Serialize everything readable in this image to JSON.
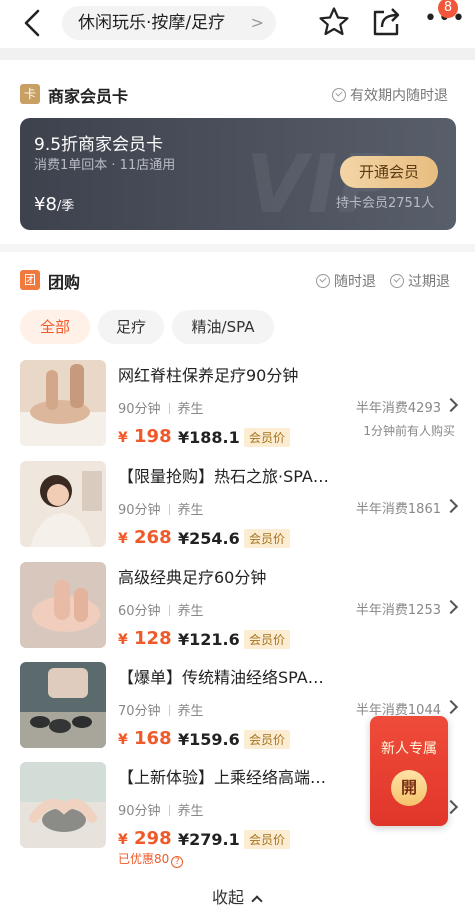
{
  "header": {
    "breadcrumb": "休闲玩乐·按摩/足疗",
    "badge_count": "8"
  },
  "member_card": {
    "section_icon": "卡",
    "section_title": "商家会员卡",
    "refund_note": "有效期内随时退",
    "card_title": "9.5折商家会员卡",
    "card_subtitle": "消费1单回本 · 11店通用",
    "price": "¥8",
    "price_unit": "/季",
    "open_button": "开通会员",
    "holders": "持卡会员2751人"
  },
  "group_buy": {
    "section_icon": "团",
    "section_title": "团购",
    "tag_anytime": "随时退",
    "tag_expired": "过期退",
    "tabs": [
      "全部",
      "足疗",
      "精油/SPA"
    ],
    "deals": [
      {
        "title": "网红脊柱保养足疗90分钟",
        "duration": "90分钟",
        "category": "养生",
        "sales": "半年消费4293",
        "extra": "1分钟前有人购买",
        "price": "198",
        "member_price": "¥188.1",
        "member_tag": "会员价",
        "icon": "massage-back-photo"
      },
      {
        "title": "【限量抢购】热石之旅·SPA…",
        "duration": "90分钟",
        "category": "养生",
        "sales": "半年消费1861",
        "extra": "",
        "price": "268",
        "member_price": "¥254.6",
        "member_tag": "会员价",
        "icon": "spa-woman-photo"
      },
      {
        "title": "高级经典足疗60分钟",
        "duration": "60分钟",
        "category": "养生",
        "sales": "半年消费1253",
        "extra": "",
        "price": "128",
        "member_price": "¥121.6",
        "member_tag": "会员价",
        "icon": "foot-massage-photo"
      },
      {
        "title": "【爆单】传统精油经络SPA…",
        "duration": "70分钟",
        "category": "养生",
        "sales": "半年消费1044",
        "extra": "",
        "price": "168",
        "member_price": "¥159.6",
        "member_tag": "会员价",
        "icon": "hot-stones-photo"
      },
      {
        "title": "【上新体验】上乘经络高端…",
        "duration": "90分钟",
        "category": "养生",
        "sales": "半",
        "extra": "",
        "price": "298",
        "member_price": "¥279.1",
        "member_tag": "会员价",
        "icon": "hands-stone-photo"
      }
    ],
    "discount_note": "已优惠80",
    "currency": "¥",
    "collapse_label": "收起"
  },
  "red_packet": {
    "title": "新人专属",
    "button": "開"
  },
  "colors": {
    "accent": "#f05a2a",
    "card_bg": "#3d424d",
    "gold": "#e8bd80"
  }
}
